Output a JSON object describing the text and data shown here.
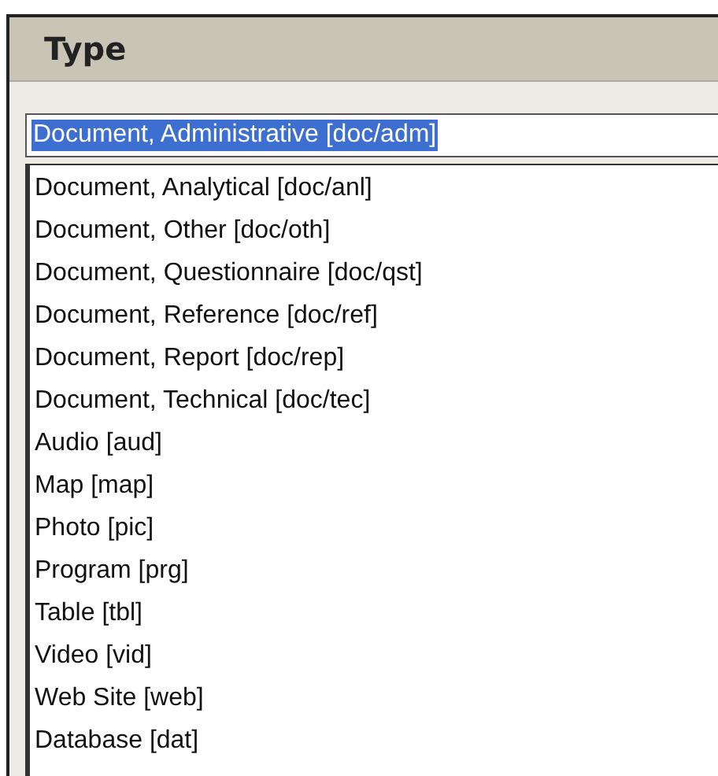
{
  "header": {
    "title": "Type"
  },
  "field": {
    "value": "Document, Administrative [doc/adm]",
    "selected": true
  },
  "list": {
    "items": [
      {
        "label": "Document, Analytical [doc/anl]",
        "selected": false
      },
      {
        "label": "Document, Other [doc/oth]",
        "selected": false
      },
      {
        "label": "Document, Questionnaire [doc/qst]",
        "selected": false
      },
      {
        "label": "Document, Reference [doc/ref]",
        "selected": false
      },
      {
        "label": "Document, Report [doc/rep]",
        "selected": false
      },
      {
        "label": "Document, Technical [doc/tec]",
        "selected": false
      },
      {
        "label": "Audio [aud]",
        "selected": false
      },
      {
        "label": "Map [map]",
        "selected": false
      },
      {
        "label": "Photo [pic]",
        "selected": false
      },
      {
        "label": "Program [prg]",
        "selected": false
      },
      {
        "label": "Table [tbl]",
        "selected": false
      },
      {
        "label": "Video [vid]",
        "selected": false
      },
      {
        "label": "Web Site [web]",
        "selected": false
      },
      {
        "label": "Database [dat]",
        "selected": false
      }
    ]
  }
}
